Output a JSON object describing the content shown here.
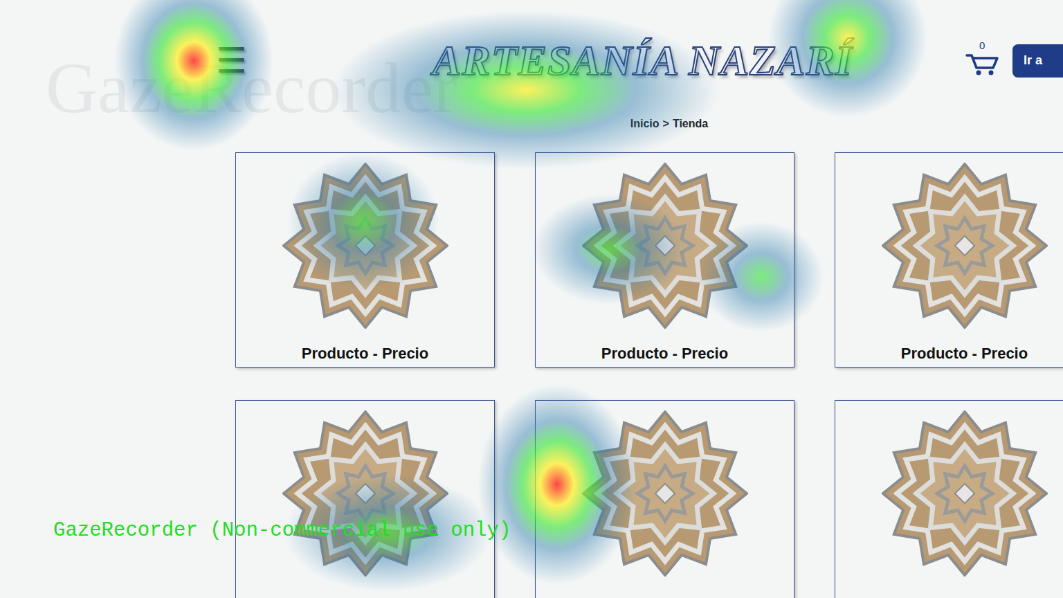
{
  "watermark": "GazeRecorder",
  "header": {
    "menu_icon": "☰",
    "title": "ARTESANÍA NAZARÍ",
    "cart_count": "0",
    "button": "Ir a"
  },
  "breadcrumb": {
    "items": [
      "Inicio",
      "Tienda"
    ],
    "separator": ">"
  },
  "products": [
    {
      "kind": "labeled",
      "label": "Producto - Precio"
    },
    {
      "kind": "labeled",
      "label": "Producto - Precio"
    },
    {
      "kind": "labeled",
      "label": "Producto - Precio"
    },
    {
      "kind": "image-only"
    },
    {
      "kind": "image-only"
    },
    {
      "kind": "image-only"
    }
  ],
  "gaze_spots": [
    {
      "level": 1.0
    },
    {
      "level": 0.7
    },
    {
      "level": 0.7
    },
    {
      "level": 0.45
    },
    {
      "level": 0.3
    },
    {
      "level": 0.25
    },
    {
      "level": 0.9
    },
    {
      "level": 0.5
    }
  ],
  "recorder_notice": "GazeRecorder (Non-commercial use only)"
}
